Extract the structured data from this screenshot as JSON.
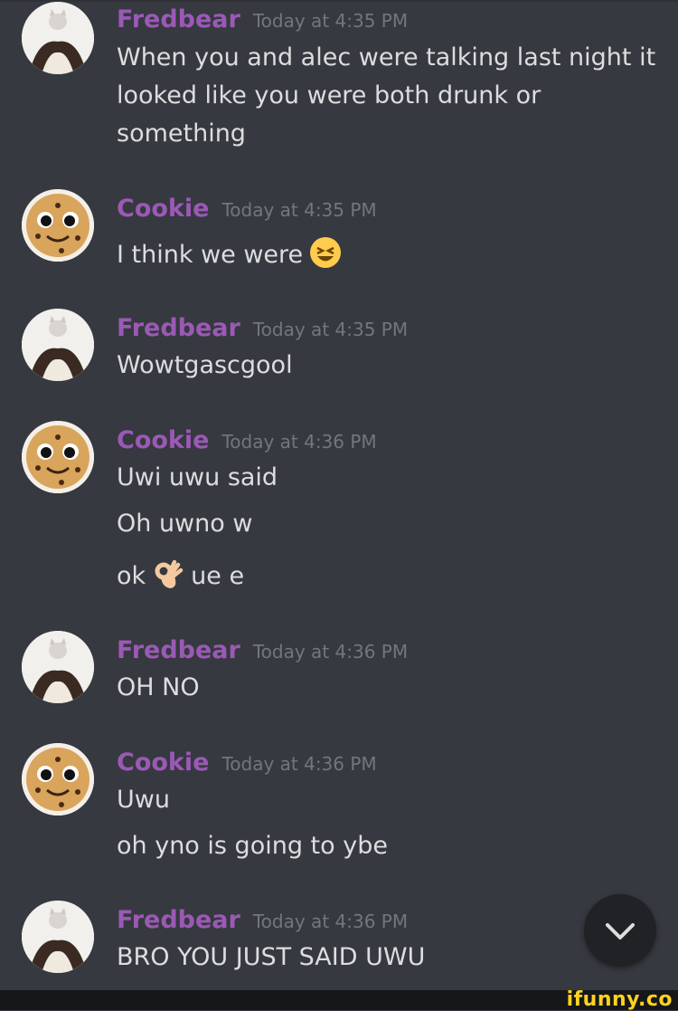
{
  "messages": [
    {
      "author": "Fredbear",
      "time": "Today at 4:35 PM",
      "avatar": "cat-avatar",
      "lines": [
        "When you and alec were talking last night it",
        "looked like you were both drunk or",
        "something"
      ]
    },
    {
      "author": "Cookie",
      "time": "Today at 4:35 PM",
      "avatar": "cookie-avatar",
      "lines": [
        "I think we were"
      ],
      "emoji": "laughing-face-emoji"
    },
    {
      "author": "Fredbear",
      "time": "Today at 4:35 PM",
      "avatar": "cat-avatar",
      "lines": [
        "Wowtgascgool"
      ]
    },
    {
      "author": "Cookie",
      "time": "Today at 4:36 PM",
      "avatar": "cookie-avatar",
      "lines": [
        "Uwi uwu said",
        "Oh uwno w"
      ],
      "ok_line": {
        "before": "ok",
        "after": "ue e",
        "emoji": "ok-hand-emoji"
      }
    },
    {
      "author": "Fredbear",
      "time": "Today at 4:36 PM",
      "avatar": "cat-avatar",
      "lines": [
        "OH NO"
      ]
    },
    {
      "author": "Cookie",
      "time": "Today at 4:36 PM",
      "avatar": "cookie-avatar",
      "lines": [
        "Uwu",
        "oh yno is going to ybe"
      ]
    },
    {
      "author": "Fredbear",
      "time": "Today at 4:36 PM",
      "avatar": "cat-avatar",
      "lines": [
        "BRO YOU JUST SAID UWU"
      ]
    }
  ],
  "jump_button_icon": "chevron-down-icon",
  "watermark": "ifunny.co",
  "colors": {
    "background": "#36393f",
    "author": "#9b59b6",
    "timestamp": "#72767d",
    "text": "#dcddde"
  }
}
